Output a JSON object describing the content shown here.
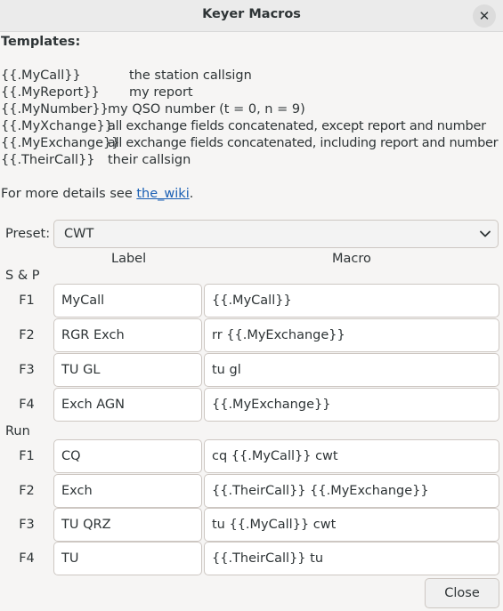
{
  "window": {
    "title": "Keyer Macros"
  },
  "templates": {
    "heading": "Templates:",
    "items": [
      {
        "code": "{{.MyCall}}",
        "desc": "the station callsign"
      },
      {
        "code": "{{.MyReport}}",
        "desc": "my report"
      },
      {
        "code": "{{.MyNumber}}",
        "desc": "my QSO number (t = 0, n = 9)"
      },
      {
        "code": "{{.MyXchange}}",
        "desc": "all exchange fields concatenated, except report and number"
      },
      {
        "code": "{{.MyExchange}}",
        "desc": "all exchange fields concatenated, including report and number"
      },
      {
        "code": "{{.TheirCall}}",
        "desc": "their callsign"
      }
    ],
    "details_prefix": "For more details see ",
    "details_link": "the_wiki",
    "details_suffix": "."
  },
  "preset": {
    "label": "Preset:",
    "value": "CWT"
  },
  "columns": {
    "label": "Label",
    "macro": "Macro"
  },
  "sp": {
    "heading": "S & P",
    "rows": [
      {
        "key": "F1",
        "label": "MyCall",
        "macro": "{{.MyCall}}"
      },
      {
        "key": "F2",
        "label": "RGR Exch",
        "macro": "rr {{.MyExchange}}"
      },
      {
        "key": "F3",
        "label": "TU GL",
        "macro": "tu gl"
      },
      {
        "key": "F4",
        "label": "Exch AGN",
        "macro": "{{.MyExchange}}"
      }
    ]
  },
  "run": {
    "heading": "Run",
    "rows": [
      {
        "key": "F1",
        "label": "CQ",
        "macro": "cq {{.MyCall}} cwt"
      },
      {
        "key": "F2",
        "label": "Exch",
        "macro": "{{.TheirCall}} {{.MyExchange}}"
      },
      {
        "key": "F3",
        "label": "TU QRZ",
        "macro": "tu {{.MyCall}} cwt"
      },
      {
        "key": "F4",
        "label": "TU",
        "macro": "{{.TheirCall}} tu"
      }
    ]
  },
  "buttons": {
    "close": "Close"
  }
}
